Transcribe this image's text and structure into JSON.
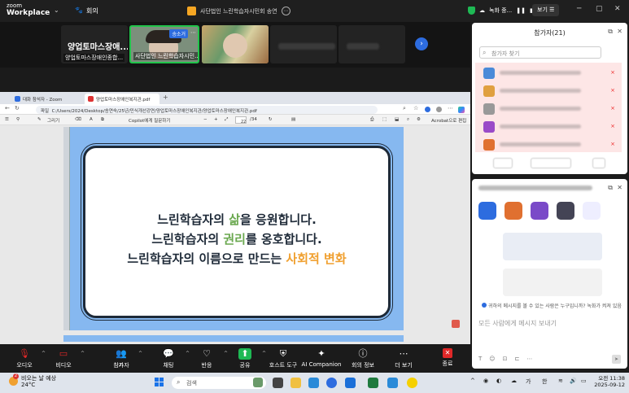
{
  "topbar": {
    "logo_top": "zoom",
    "logo_bottom": "Workplace",
    "meeting_label": "회의",
    "meeting_title": "사단법인 느린학습자시민회 송연",
    "recording_label": "녹화 중...",
    "view_label": "보기"
  },
  "strip": {
    "tiles": [
      {
        "big": "양업토마스장애...",
        "name": "양업토마스장애인종합..."
      },
      {
        "tag": "송소거",
        "name": "사단법인 느린학습자시민..."
      },
      {
        "name": ""
      },
      {
        "name": ""
      },
      {
        "name": ""
      }
    ]
  },
  "browser": {
    "tab1": "대화 참석자 - Zoom",
    "tab2": "양업토마스장애인복지관.pdf",
    "url_prefix": "파일",
    "url": "C:/Users/2024/Desktop/송연숙/25년/민식개선강연/양업토마스장애인복지관/양업토마스장애인복지관.pdf",
    "pdf_tools": {
      "draw": "그리기",
      "copilot": "Copilot에게 질문하기",
      "page": "22",
      "page_total": "/34",
      "acrobat": "Acrobat으로 편집"
    }
  },
  "slide": {
    "line1_a": "느린학습자의 ",
    "line1_b": "삶",
    "line1_c": "을 응원합니다.",
    "line2_a": "느린학습자의 ",
    "line2_b": "권리",
    "line2_c": "를 옹호합니다.",
    "line3_a": "느린학습자의 이름으로 만드는 ",
    "line3_b": "사회적 변화"
  },
  "participants": {
    "title": "참가자(21)",
    "search_placeholder": "참가자 찾기"
  },
  "chat": {
    "notice": "귀하의 메시지를 볼 수 있는 사람은 누구입니까? 녹화가 켜져 있음",
    "input_placeholder": "모든 사람에게 메시지 보내기"
  },
  "toolbar": {
    "audio": "오디오",
    "video": "비디오",
    "participants": "참가자",
    "participants_count": "21",
    "chat": "채팅",
    "react": "반응",
    "share": "공유",
    "host_tools": "호스트 도구",
    "ai": "AI Companion",
    "info": "회의 정보",
    "more": "더 보기",
    "end": "종료"
  },
  "taskbar": {
    "weather_title": "비오는 날 예상",
    "weather_temp": "24°C",
    "search_placeholder": "검색",
    "ime1": "가",
    "ime2": "한",
    "time": "오전 11:38",
    "date": "2025-09-12"
  },
  "colors": {
    "zoom_blue": "#2d6cdf",
    "end_red": "#e02828",
    "slide_blue": "#86b8f0",
    "green_text": "#6aa84f",
    "orange_text": "#f0a030"
  }
}
